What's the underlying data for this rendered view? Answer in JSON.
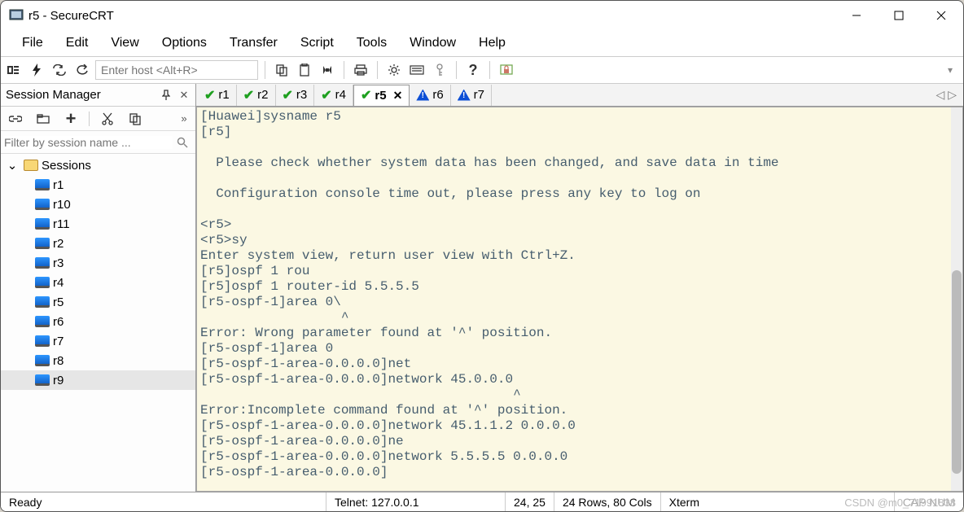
{
  "window": {
    "title": "r5 - SecureCRT"
  },
  "menu": {
    "items": [
      "File",
      "Edit",
      "View",
      "Options",
      "Transfer",
      "Script",
      "Tools",
      "Window",
      "Help"
    ]
  },
  "toolbar": {
    "host_placeholder": "Enter host <Alt+R>"
  },
  "sidebar": {
    "title": "Session Manager",
    "filter_placeholder": "Filter by session name ...",
    "root": "Sessions",
    "items": [
      "r1",
      "r10",
      "r11",
      "r2",
      "r3",
      "r4",
      "r5",
      "r6",
      "r7",
      "r8",
      "r9"
    ],
    "selected": "r9"
  },
  "tabs": [
    {
      "label": "r1",
      "status": "ok"
    },
    {
      "label": "r2",
      "status": "ok"
    },
    {
      "label": "r3",
      "status": "ok"
    },
    {
      "label": "r4",
      "status": "ok"
    },
    {
      "label": "r5",
      "status": "ok",
      "active": true,
      "closable": true
    },
    {
      "label": "r6",
      "status": "warn"
    },
    {
      "label": "r7",
      "status": "warn"
    }
  ],
  "terminal": {
    "lines": [
      "[Huawei]sysname r5",
      "[r5]",
      "",
      "  Please check whether system data has been changed, and save data in time",
      "",
      "  Configuration console time out, please press any key to log on",
      "",
      "<r5>",
      "<r5>sy",
      "Enter system view, return user view with Ctrl+Z.",
      "[r5]ospf 1 rou",
      "[r5]ospf 1 router-id 5.5.5.5",
      "[r5-ospf-1]area 0\\",
      "                  ^",
      "Error: Wrong parameter found at '^' position.",
      "[r5-ospf-1]area 0",
      "[r5-ospf-1-area-0.0.0.0]net",
      "[r5-ospf-1-area-0.0.0.0]network 45.0.0.0",
      "                                        ^",
      "Error:Incomplete command found at '^' position.",
      "[r5-ospf-1-area-0.0.0.0]network 45.1.1.2 0.0.0.0",
      "[r5-ospf-1-area-0.0.0.0]ne",
      "[r5-ospf-1-area-0.0.0.0]network 5.5.5.5 0.0.0.0",
      "[r5-ospf-1-area-0.0.0.0]"
    ]
  },
  "status": {
    "ready": "Ready",
    "conn": "Telnet: 127.0.0.1",
    "pos": "24,  25",
    "size": "24 Rows, 80 Cols",
    "emu": "Xterm",
    "extra": "CAP NUM"
  },
  "watermark": "CSDN @m0_71991838"
}
